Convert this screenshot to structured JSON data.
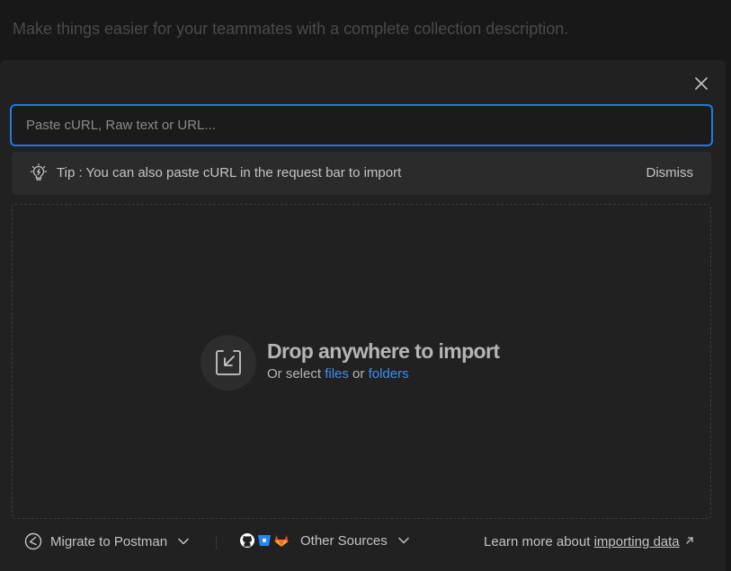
{
  "background": {
    "description_placeholder": "Make things easier for your teammates with a complete collection description."
  },
  "import_modal": {
    "url_input": {
      "placeholder": "Paste cURL, Raw text or URL...",
      "value": ""
    },
    "tip": {
      "text": "Tip : You can also paste cURL in the request bar to import",
      "dismiss_label": "Dismiss"
    },
    "dropzone": {
      "title": "Drop anywhere to import",
      "subtitle_prefix": "Or select",
      "files_link": "files",
      "conjunction": "or",
      "folders_link": "folders"
    },
    "footer": {
      "migrate_label": "Migrate to Postman",
      "other_sources_label": "Other Sources",
      "learn_more_prefix": "Learn more about",
      "learn_more_link": "importing data"
    }
  },
  "colors": {
    "accent": "#1f7ae8",
    "link": "#3f8ff0",
    "github": "#ffffff",
    "bitbucket": "#2684ff",
    "gitlab": "#e24329"
  },
  "icons": {
    "close": "close-icon",
    "tip": "lightbulb-icon",
    "drop": "import-icon",
    "migrate": "postman-icon",
    "sources": [
      "github-icon",
      "bitbucket-icon",
      "gitlab-icon"
    ],
    "external": "arrow-up-right-icon"
  }
}
